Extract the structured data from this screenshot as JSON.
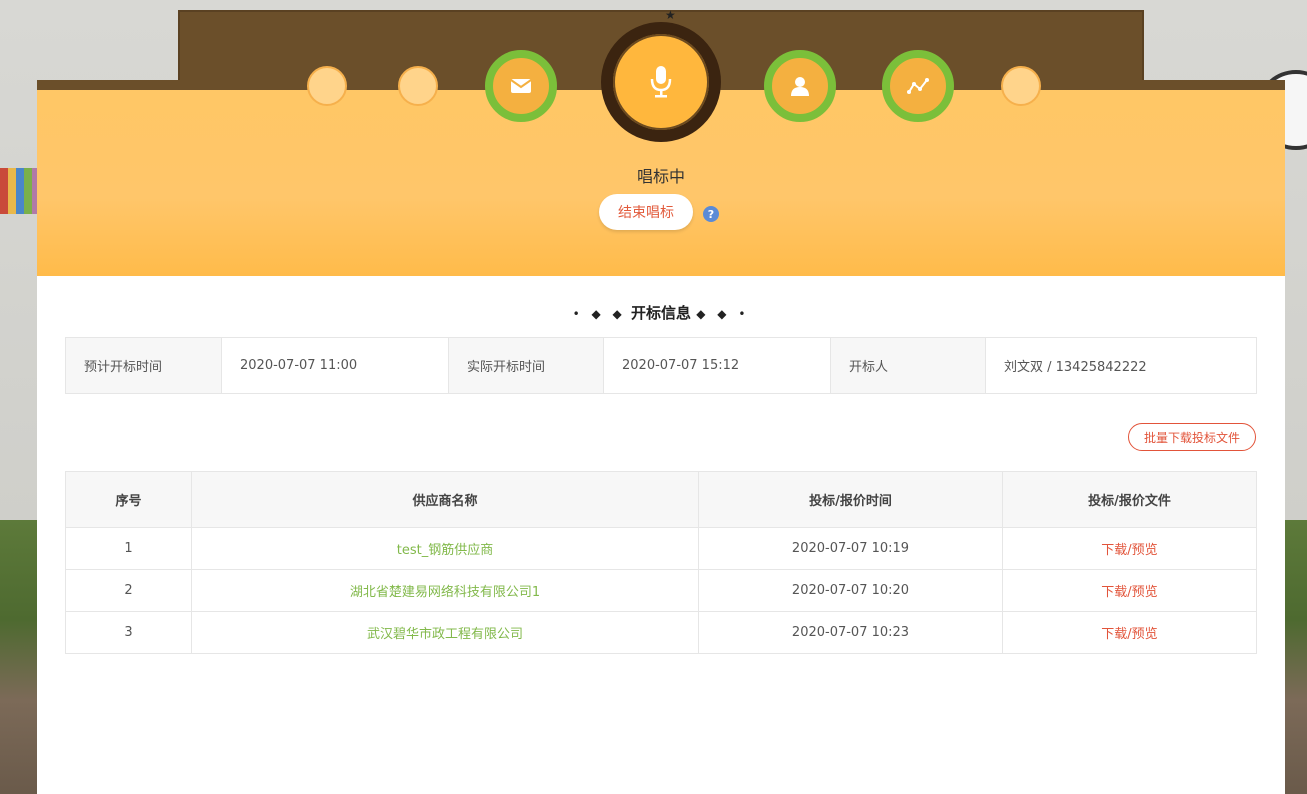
{
  "status_text": "唱标中",
  "end_button_label": "结束唱标",
  "help_icon_label": "?",
  "section_title": "开标信息",
  "section_title_left_ornament": "• ◆ ◆",
  "section_title_right_ornament": "◆ ◆ •",
  "info": {
    "planned_label": "预计开标时间",
    "planned_value": "2020-07-07 11:00",
    "actual_label": "实际开标时间",
    "actual_value": "2020-07-07 15:12",
    "opener_label": "开标人",
    "opener_value": "刘文双 / 13425842222"
  },
  "batch_download_label": "批量下载投标文件",
  "table": {
    "headers": [
      "序号",
      "供应商名称",
      "投标/报价时间",
      "投标/报价文件"
    ],
    "rows": [
      {
        "index": "1",
        "supplier": "test_钢筋供应商",
        "time": "2020-07-07 10:19",
        "file": "下载/预览"
      },
      {
        "index": "2",
        "supplier": "湖北省楚建易网络科技有限公司1",
        "time": "2020-07-07 10:20",
        "file": "下载/预览"
      },
      {
        "index": "3",
        "supplier": "武汉碧华市政工程有限公司",
        "time": "2020-07-07 10:23",
        "file": "下载/预览"
      }
    ]
  },
  "steps": [
    {
      "icon": "circle-icon",
      "state": "inactive"
    },
    {
      "icon": "circle-icon",
      "state": "inactive"
    },
    {
      "icon": "envelope-icon",
      "state": "done"
    },
    {
      "icon": "microphone-icon",
      "state": "current"
    },
    {
      "icon": "user-icon",
      "state": "done"
    },
    {
      "icon": "chart-icon",
      "state": "done"
    },
    {
      "icon": "circle-icon",
      "state": "inactive"
    }
  ],
  "colors": {
    "hero": "#ffc765",
    "accent_red": "#e2543a",
    "supplier_green": "#82b94b",
    "step_green": "#7bbf3a"
  }
}
